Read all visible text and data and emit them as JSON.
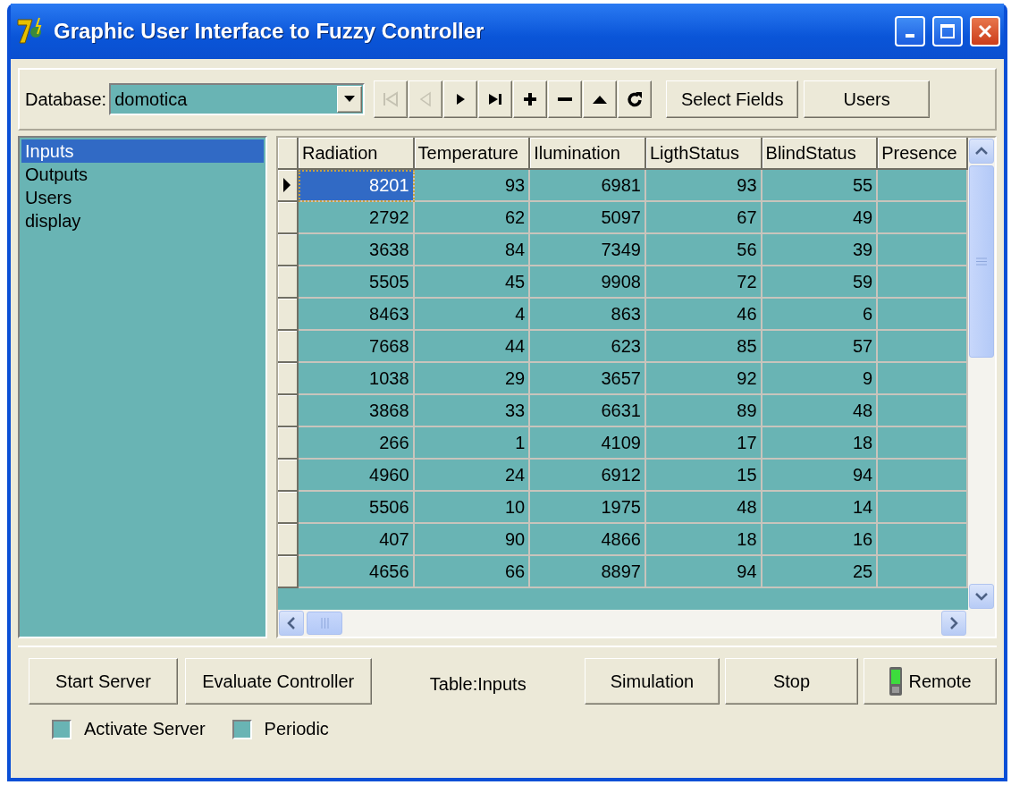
{
  "window": {
    "title": "Graphic User Interface to Fuzzy Controller"
  },
  "toolbar": {
    "database_label": "Database:",
    "database": "domotica",
    "navigator": [
      {
        "kind": "first",
        "disabled": true
      },
      {
        "kind": "prior",
        "disabled": true
      },
      {
        "kind": "next",
        "disabled": false
      },
      {
        "kind": "last",
        "disabled": false
      },
      {
        "kind": "insert",
        "disabled": false
      },
      {
        "kind": "delete",
        "disabled": false
      },
      {
        "kind": "edit",
        "disabled": false
      },
      {
        "kind": "refresh",
        "disabled": false
      }
    ],
    "buttons": [
      "Select Fields",
      "Users"
    ]
  },
  "tables_list": {
    "items": [
      {
        "label": "Inputs",
        "selected": true
      },
      {
        "label": "Outputs",
        "selected": false
      },
      {
        "label": "Users",
        "selected": false
      },
      {
        "label": "display",
        "selected": false
      }
    ]
  },
  "grid": {
    "columns": [
      "Radiation",
      "Temperature",
      "Ilumination",
      "LigthStatus",
      "BlindStatus",
      "Presence"
    ],
    "rows": [
      {
        "selected": true,
        "cells": [
          "8201",
          "93",
          "6981",
          "93",
          "55"
        ]
      },
      {
        "selected": false,
        "cells": [
          "2792",
          "62",
          "5097",
          "67",
          "49"
        ]
      },
      {
        "selected": false,
        "cells": [
          "3638",
          "84",
          "7349",
          "56",
          "39"
        ]
      },
      {
        "selected": false,
        "cells": [
          "5505",
          "45",
          "9908",
          "72",
          "59"
        ]
      },
      {
        "selected": false,
        "cells": [
          "8463",
          "4",
          "863",
          "46",
          "6"
        ]
      },
      {
        "selected": false,
        "cells": [
          "7668",
          "44",
          "623",
          "85",
          "57"
        ]
      },
      {
        "selected": false,
        "cells": [
          "1038",
          "29",
          "3657",
          "92",
          "9"
        ]
      },
      {
        "selected": false,
        "cells": [
          "3868",
          "33",
          "6631",
          "89",
          "48"
        ]
      },
      {
        "selected": false,
        "cells": [
          "266",
          "1",
          "4109",
          "17",
          "18"
        ]
      },
      {
        "selected": false,
        "cells": [
          "4960",
          "24",
          "6912",
          "15",
          "94"
        ]
      },
      {
        "selected": false,
        "cells": [
          "5506",
          "10",
          "1975",
          "48",
          "14"
        ]
      },
      {
        "selected": false,
        "cells": [
          "407",
          "90",
          "4866",
          "18",
          "16"
        ]
      },
      {
        "selected": false,
        "cells": [
          "4656",
          "66",
          "8897",
          "94",
          "25"
        ]
      }
    ]
  },
  "bottom": {
    "left_buttons": [
      "Start Server",
      "Evaluate Controller"
    ],
    "table_label": "Table:Inputs",
    "right_buttons": [
      {
        "label": "Simulation",
        "kind": "plain"
      },
      {
        "label": "Stop",
        "kind": "plain"
      },
      {
        "label": "Remote",
        "kind": "device"
      }
    ],
    "checkboxes": [
      {
        "label": "Activate Server",
        "checked": false
      },
      {
        "label": "Periodic",
        "checked": false
      }
    ]
  }
}
